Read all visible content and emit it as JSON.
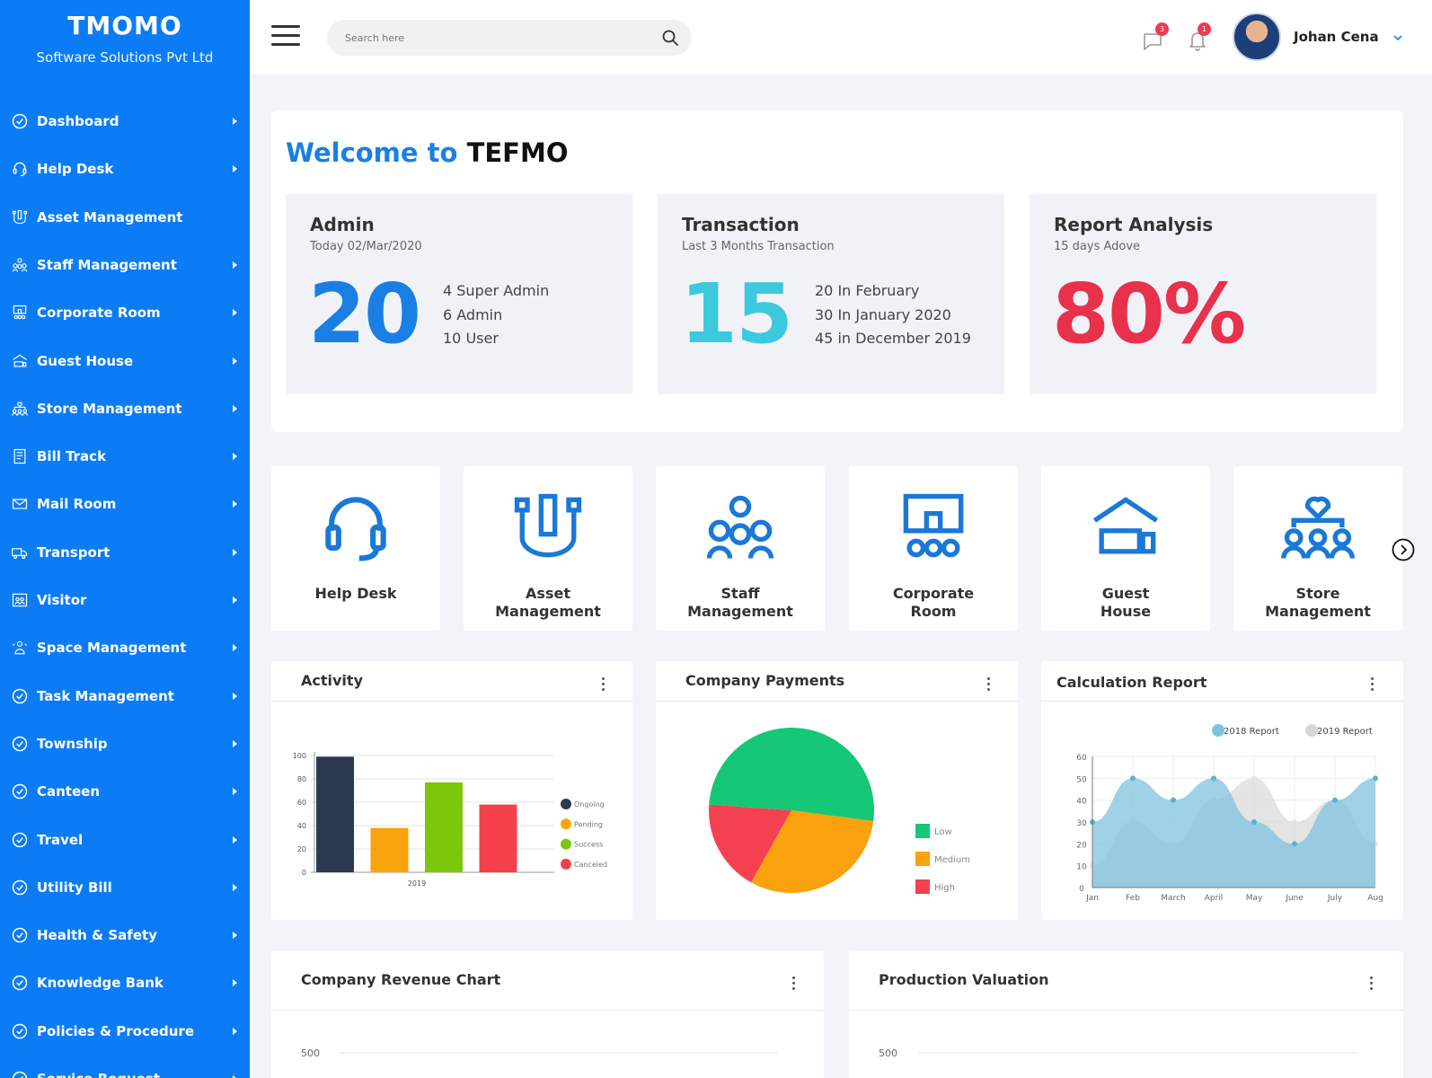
{
  "brand": {
    "title": "TMOMO",
    "subtitle": "Software Solutions Pvt Ltd"
  },
  "colors": {
    "sidebar": "#0c7cf6",
    "accent_blue": "#1a7fe3",
    "teal": "#3cc8dd",
    "red": "#e8314b",
    "icon_blue": "#1a78d8"
  },
  "sidebar": {
    "items": [
      {
        "label": "Dashboard",
        "icon": "dashboard-icon",
        "has_submenu": true
      },
      {
        "label": "Help Desk",
        "icon": "headset-icon",
        "has_submenu": true
      },
      {
        "label": "Asset Management",
        "icon": "asset-icon",
        "has_submenu": false
      },
      {
        "label": "Staff Management",
        "icon": "staff-icon",
        "has_submenu": true
      },
      {
        "label": "Corporate Room",
        "icon": "podium-icon",
        "has_submenu": true
      },
      {
        "label": "Guest House",
        "icon": "bed-icon",
        "has_submenu": true
      },
      {
        "label": "Store Management",
        "icon": "store-icon",
        "has_submenu": true
      },
      {
        "label": "Bill Track",
        "icon": "bill-icon",
        "has_submenu": true
      },
      {
        "label": "Mail Room",
        "icon": "mail-icon",
        "has_submenu": true
      },
      {
        "label": "Transport",
        "icon": "truck-icon",
        "has_submenu": true
      },
      {
        "label": "Visitor",
        "icon": "visitor-icon",
        "has_submenu": true
      },
      {
        "label": "Space Management",
        "icon": "space-icon",
        "has_submenu": true
      },
      {
        "label": "Task Management",
        "icon": "dashboard-icon",
        "has_submenu": true
      },
      {
        "label": "Township",
        "icon": "dashboard-icon",
        "has_submenu": true
      },
      {
        "label": "Canteen",
        "icon": "dashboard-icon",
        "has_submenu": true
      },
      {
        "label": "Travel",
        "icon": "dashboard-icon",
        "has_submenu": true
      },
      {
        "label": "Utility Bill",
        "icon": "dashboard-icon",
        "has_submenu": true
      },
      {
        "label": "Health & Safety",
        "icon": "dashboard-icon",
        "has_submenu": true
      },
      {
        "label": "Knowledge Bank",
        "icon": "dashboard-icon",
        "has_submenu": true
      },
      {
        "label": "Policies & Procedure",
        "icon": "dashboard-icon",
        "has_submenu": true
      },
      {
        "label": "Service Request",
        "icon": "dashboard-icon",
        "has_submenu": true
      }
    ]
  },
  "topbar": {
    "search_placeholder": "Search here",
    "messages_count": "3",
    "notifications_count": "1",
    "user_name": "Johan Cena"
  },
  "welcome": {
    "prefix": "Welcome to",
    "name": "TEFMO",
    "cards": [
      {
        "title": "Admin",
        "subtitle": "Today 02/Mar/2020",
        "value": "20",
        "color": "#1a7fe3",
        "lines": [
          "4 Super Admin",
          "6 Admin",
          "10 User"
        ]
      },
      {
        "title": "Transaction",
        "subtitle": "Last 3 Months Transaction",
        "value": "15",
        "color": "#3cc8dd",
        "lines": [
          "20 In February",
          "30 In January 2020",
          "45 in December 2019"
        ]
      },
      {
        "title": "Report Analysis",
        "subtitle": "15 days Adove",
        "value": "80%",
        "color": "#e8314b",
        "lines": []
      }
    ]
  },
  "modules": [
    {
      "label": "Help Desk",
      "icon": "headset-icon"
    },
    {
      "label": "Asset\nManagement",
      "icon": "asset-icon"
    },
    {
      "label": "Staff\nManagement",
      "icon": "staff-icon"
    },
    {
      "label": "Corporate\nRoom",
      "icon": "podium-icon"
    },
    {
      "label": "Guest\nHouse",
      "icon": "bed-icon"
    },
    {
      "label": "Store\nManagement",
      "icon": "store-icon"
    }
  ],
  "cards": {
    "activity": "Activity",
    "payments": "Company Payments",
    "calc": "Calculation Report",
    "revenue": "Company Revenue Chart",
    "production": "Production Valuation"
  },
  "chart_data": [
    {
      "type": "bar",
      "title": "Activity",
      "categories": [
        "2019"
      ],
      "series": [
        {
          "name": "Ongoing",
          "values": [
            99
          ],
          "color": "#2b3a4f"
        },
        {
          "name": "Pending",
          "values": [
            38
          ],
          "color": "#f8a40c"
        },
        {
          "name": "Success",
          "values": [
            77
          ],
          "color": "#7ac70c"
        },
        {
          "name": "Canceled",
          "values": [
            58
          ],
          "color": "#f44149"
        }
      ],
      "yticks": [
        0,
        20,
        40,
        60,
        80,
        100
      ],
      "ylim": [
        0,
        100
      ],
      "legend": "right"
    },
    {
      "type": "pie",
      "title": "Company Payments",
      "slices": [
        {
          "name": "Low",
          "value": 51,
          "color": "#16c775"
        },
        {
          "name": "Medium",
          "value": 31,
          "color": "#f9a20e"
        },
        {
          "name": "High",
          "value": 18,
          "color": "#f34150"
        }
      ],
      "legend": "right"
    },
    {
      "type": "area",
      "title": "Calculation Report",
      "x": [
        "Jan",
        "Feb",
        "March",
        "April",
        "May",
        "June",
        "July",
        "Aug"
      ],
      "series": [
        {
          "name": "2018 Report",
          "values": [
            30,
            50,
            40,
            50,
            30,
            20,
            40,
            50
          ],
          "color": "#7fc3df"
        },
        {
          "name": "2019 Report",
          "values": [
            10,
            30,
            20,
            40,
            50,
            30,
            40,
            20
          ],
          "color": "#d8d8d8"
        }
      ],
      "yticks": [
        0,
        10,
        20,
        30,
        40,
        50,
        60
      ],
      "ylim": [
        0,
        60
      ],
      "grid": true,
      "legend": "top-right"
    },
    {
      "type": "line",
      "title": "Company Revenue Chart",
      "yticks_visible": [
        500
      ]
    },
    {
      "type": "line",
      "title": "Production Valuation",
      "yticks_visible": [
        500
      ]
    }
  ]
}
